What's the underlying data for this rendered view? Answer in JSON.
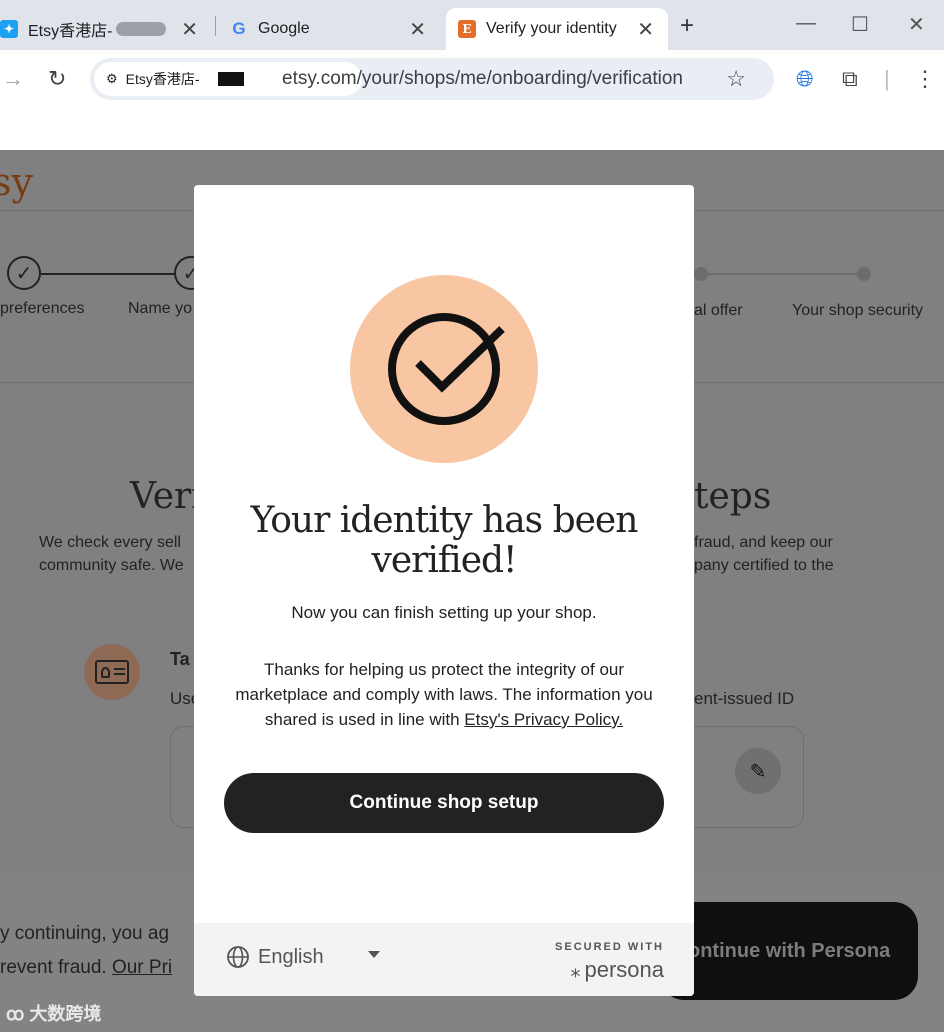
{
  "browser": {
    "tabs": [
      {
        "title": "Etsy香港店-"
      },
      {
        "title": "Google"
      },
      {
        "title": "Verify your identity"
      }
    ],
    "site_chip": "Etsy香港店-",
    "url": "etsy.com/your/shops/me/onboarding/verification"
  },
  "background": {
    "logo": "sy",
    "steps": [
      "preferences",
      "Name yo",
      "al offer",
      "Your shop security"
    ],
    "heading_left": "Veri",
    "heading_right": "teps",
    "text_left_1": "We check every sell",
    "text_left_2": "community safe. We",
    "text_right_1": "fraud, and keep our",
    "text_right_2": "pany certified to the",
    "card_title": "Ta",
    "card_text_left": "Use",
    "card_text_right": "ent-issued ID",
    "consent_1": "y continuing, you ag",
    "consent_2_prefix": "revent fraud. ",
    "consent_2_link": "Our Pri",
    "persona_button": "ontinue with Persona",
    "watermark": "大数跨境"
  },
  "modal": {
    "title": "Your identity has been verified!",
    "subtitle": "Now you can finish setting up your shop.",
    "body": "Thanks for helping us protect the integrity of our marketplace and comply with laws. The information you shared is used in line with ",
    "privacy_link": "Etsy's Privacy Policy.",
    "continue_button": "Continue shop setup",
    "language": "English",
    "secured_with": "SECURED WITH",
    "persona": "persona",
    "check_color": "#f9c6a3"
  }
}
